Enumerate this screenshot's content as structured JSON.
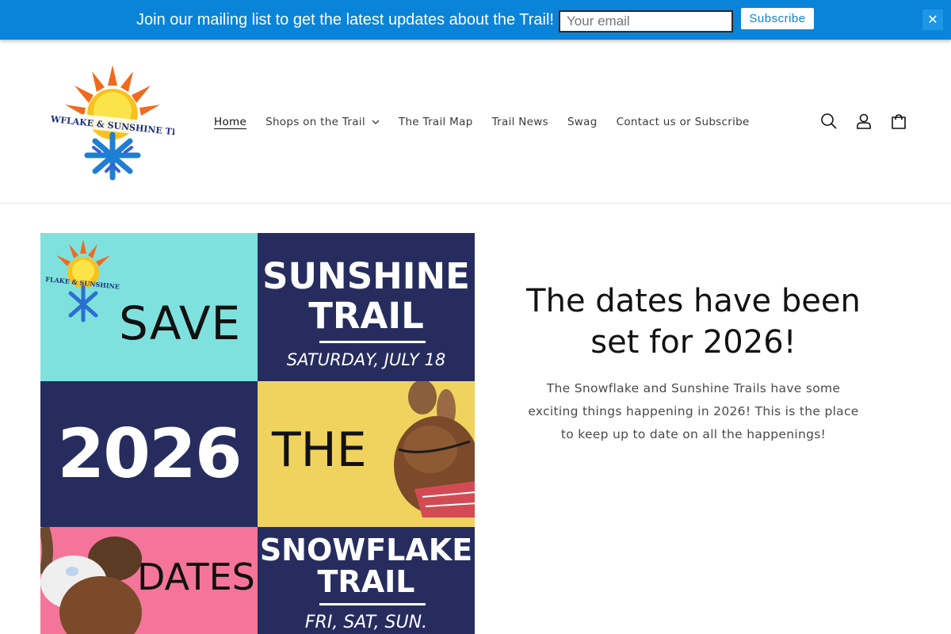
{
  "mailbar": {
    "text": "Join our mailing list to get the latest updates about the Trail!",
    "email_placeholder": "Your email",
    "subscribe_label": "Subscribe",
    "close_label": "✕"
  },
  "header": {
    "logo_text": "Snowflake & Sunshine Trail",
    "nav": [
      {
        "label": "Home",
        "active": true
      },
      {
        "label": "Shops on the Trail",
        "dropdown": true
      },
      {
        "label": "The Trail Map"
      },
      {
        "label": "Trail News"
      },
      {
        "label": "Swag"
      },
      {
        "label": "Contact us or Subscribe"
      }
    ],
    "icons": [
      "search-icon",
      "account-icon",
      "cart-icon"
    ]
  },
  "banner": {
    "save": "SAVE",
    "sunshine_title_1": "SUNSHINE",
    "sunshine_title_2": "TRAIL",
    "sunshine_date": "SATURDAY, JULY 18",
    "year": "2026",
    "the": "THE",
    "dates": "DATES",
    "snowflake_title_1": "SNOWFLAKE",
    "snowflake_title_2": "TRAIL",
    "snowflake_date": "FRI, SAT, SUN."
  },
  "main": {
    "heading": "The dates have been set for 2026!",
    "body": "The Snowflake and Sunshine Trails have some exciting things happening in 2026! This is the place to keep up to date on all the happenings!"
  },
  "colors": {
    "mailbar_bg": "#0a84d8",
    "teal": "#7fe1dd",
    "navy": "#262d5e",
    "yellow": "#f0d35e",
    "pink": "#f5759a"
  }
}
